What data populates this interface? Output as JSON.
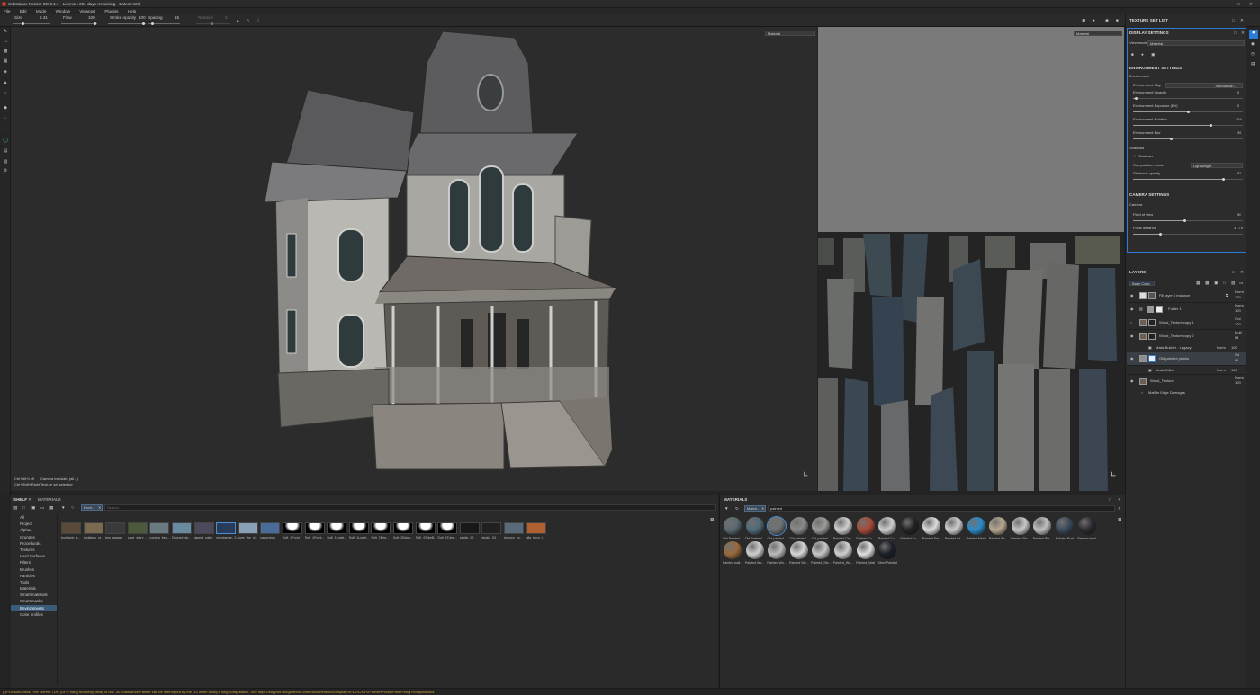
{
  "window": {
    "title": "Substance Painter 2019.1.1 - License: 261 days remaining - Bates Hotel"
  },
  "menu": [
    "File",
    "Edit",
    "Mode",
    "Window",
    "Viewport",
    "Plugins",
    "Help"
  ],
  "toolbar": {
    "size_label": "Size",
    "size_value": "6.31",
    "flow_label": "Flow",
    "flow_value": "100",
    "stroke_opacity_label": "Stroke opacity",
    "stroke_opacity_value": "100",
    "spacing_label": "Spacing",
    "spacing_value": "15",
    "rotation_label": "Rotation",
    "rotation_value": "0"
  },
  "viewport3d": {
    "mode": "Material",
    "hint1_key": "Ctrl+Alt+Left",
    "hint1_val": "Camera translate (all...)",
    "hint2_key": "Ctrl+Shift+Right",
    "hint2_val": "Texture set selection"
  },
  "viewport2d": {
    "mode": "Material"
  },
  "texture_set_list": {
    "title": "TEXTURE SET LIST"
  },
  "display_settings": {
    "title": "DISPLAY SETTINGS",
    "view_mode_label": "View mode",
    "view_mode_value": "Material",
    "env_section": "ENVIRONMENT SETTINGS",
    "env_label": "Environment",
    "env_map_label": "Environment Map",
    "env_map_value": "mondaman...",
    "env_opacity_label": "Environment Opacity",
    "env_opacity_value": "0",
    "env_opacity_frac": 0.03,
    "env_exposure_label": "Environment Exposure (EV)",
    "env_exposure_value": "0",
    "env_exposure_frac": 0.5,
    "env_rotation_label": "Environment Rotation",
    "env_rotation_value": "254",
    "env_rotation_frac": 0.71,
    "env_blur_label": "Environment Blur",
    "env_blur_value": "35",
    "env_blur_frac": 0.35,
    "shadows_label": "Shadows",
    "shadows_check_label": "Shadows",
    "comp_mode_label": "Computation mode",
    "comp_mode_value": "Lightweight",
    "shadow_opacity_label": "Shadows opacity",
    "shadow_opacity_value": "82",
    "shadow_opacity_frac": 0.82,
    "camera_section": "CAMERA SETTINGS",
    "camera_label": "Camera",
    "fov_label": "Field of view",
    "fov_value": "50",
    "fov_frac": 0.47,
    "focal_label": "Focal distance",
    "focal_value": "37.79",
    "focal_frac": 0.25
  },
  "layers": {
    "title": "LAYERS",
    "channel": "Base Color",
    "items": [
      {
        "name": "Fill layer 1 instance",
        "blend": "Norm",
        "opacity": "100"
      },
      {
        "name": "Folder 1",
        "blend": "Norm",
        "opacity": "100"
      },
      {
        "name": "Wood_Texture copy 1",
        "blend": "Ovrl",
        "opacity": "100"
      },
      {
        "name": "Wood_Texture copy 2",
        "blend": "Mult",
        "opacity": "84"
      },
      {
        "name": "Mask Builder - Legacy",
        "blend": "Norm",
        "opacity": "100"
      },
      {
        "name": "Old painted planks",
        "blend": "Sd",
        "opacity": "95"
      },
      {
        "name": "Mask Editor",
        "blend": "Norm",
        "opacity": "100"
      },
      {
        "name": "Wood_Texture",
        "blend": "Norm",
        "opacity": "100"
      },
      {
        "name": "MatFin Edge Damages",
        "blend": "",
        "opacity": ""
      }
    ]
  },
  "shelf": {
    "tab_shelf": "SHELF",
    "tab_materials": "MATERIALS",
    "filter_chip": "Envir...",
    "search_placeholder": "Search...",
    "categories": [
      "All",
      "Project",
      "Alphas",
      "Grunges",
      "Procedurals",
      "Textures",
      "Hard Surfaces",
      "Filters",
      "Brushes",
      "Particles",
      "Tools",
      "Materials",
      "Smart materials",
      "Smart masks",
      "Environments",
      "Color profiles"
    ],
    "selected_category": "Environments",
    "items": [
      "bonifacio_a...",
      "bonifacio_st...",
      "bus_garage",
      "cave_entry_...",
      "corsica_bea...",
      "Ditoned_str...",
      "glazed_patio",
      "mondarnan_3...",
      "over_the_cl...",
      "panorama",
      "Soft_1Front",
      "Soft_1Front...",
      "Soft_1Lowfr...",
      "Soft_1Lowfr...",
      "Soft_2Brig...",
      "Soft_2Brigh...",
      "Soft_4TubeB...",
      "Soft_4Tube...",
      "studio_02",
      "studio_03",
      "tomoco_ev...",
      "ulla_turra_t..."
    ]
  },
  "materials": {
    "title": "MATERIALS",
    "filter_chip": "Materi...",
    "search_value": "painted",
    "row1": [
      "Old Painted...",
      "Old Painted...",
      "Old painted...",
      "Old painted...",
      "Old painted...",
      "Painted Chy...",
      "Painted Co...",
      "Painted Co...",
      "Painted Co...",
      "Painted Fer...",
      "Painted Int...",
      "Painted Metal",
      "Painted Pa...",
      "Painted Pla...",
      "Painted Pla...",
      "Painted Rust",
      "Painted steel"
    ],
    "row2": [
      "Painted wall...",
      "Painted Wo...",
      "Painted Wo...",
      "Painted Wo...",
      "Painted_Ste...",
      "Painted_Wo...",
      "Painted_Wall",
      "Steel Painted"
    ]
  },
  "status": {
    "message": "[GPUIssueCheck] The current TDR (GPU hang recovery) delay is low: 2s. Substance Painter can be interrupted by the OS when doing a long computation. See https://support.allegorithmic.com/documentation/display/SPDOC/GPU+drivers+crash+with+long+computations"
  }
}
